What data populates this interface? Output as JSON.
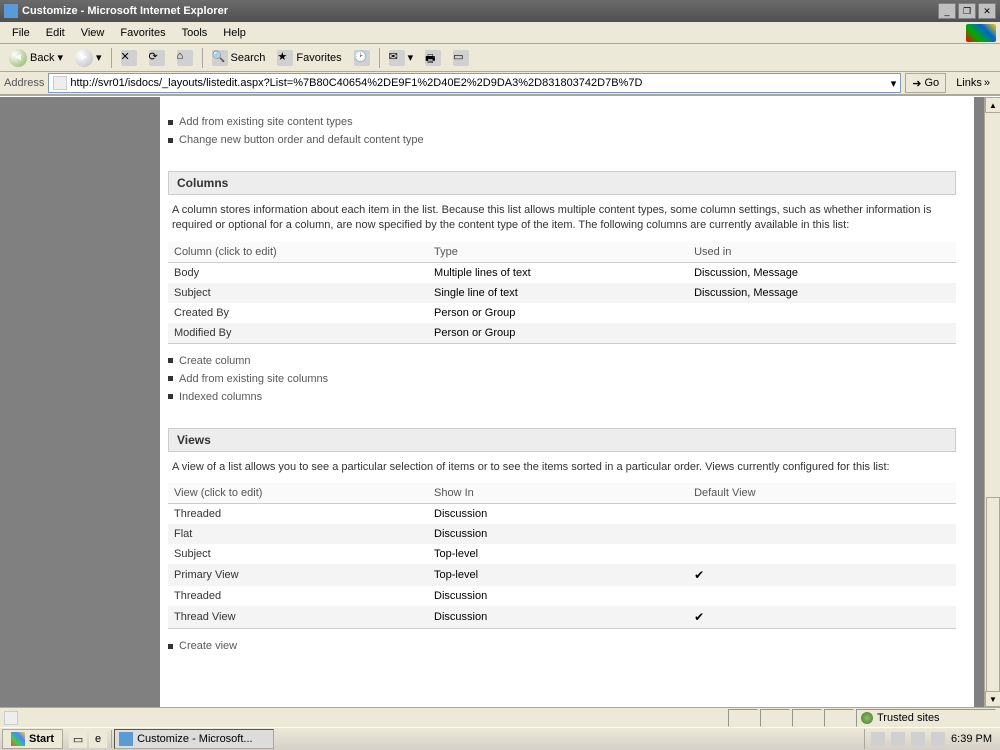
{
  "window": {
    "title": "Customize - Microsoft Internet Explorer"
  },
  "menu": {
    "file": "File",
    "edit": "Edit",
    "view": "View",
    "favorites": "Favorites",
    "tools": "Tools",
    "help": "Help"
  },
  "toolbar": {
    "back": "Back",
    "search": "Search",
    "favorites": "Favorites"
  },
  "address": {
    "label": "Address",
    "value": "http://svr01/isdocs/_layouts/listedit.aspx?List=%7B80C40654%2DE9F1%2D40E2%2D9DA3%2D831803742D7B%7D",
    "go": "Go",
    "links": "Links"
  },
  "content_types": {
    "actions": [
      "Add from existing site content types",
      "Change new button order and default content type"
    ]
  },
  "columns_section": {
    "heading": "Columns",
    "description": "A column stores information about each item in the list. Because this list allows multiple content types, some column settings, such as whether information is required or optional for a column, are now specified by the content type of the item. The following columns are currently available in this list:",
    "headers": {
      "col": "Column (click to edit)",
      "type": "Type",
      "usedin": "Used in"
    },
    "rows": [
      {
        "name": "Body",
        "type": "Multiple lines of text",
        "usedin": "Discussion, Message"
      },
      {
        "name": "Subject",
        "type": "Single line of text",
        "usedin": "Discussion, Message"
      },
      {
        "name": "Created By",
        "type": "Person or Group",
        "usedin": ""
      },
      {
        "name": "Modified By",
        "type": "Person or Group",
        "usedin": ""
      }
    ],
    "actions": [
      "Create column",
      "Add from existing site columns",
      "Indexed columns"
    ]
  },
  "views_section": {
    "heading": "Views",
    "description": "A view of a list allows you to see a particular selection of items or to see the items sorted in a particular order. Views currently configured for this list:",
    "headers": {
      "view": "View (click to edit)",
      "showin": "Show In",
      "default": "Default View"
    },
    "rows": [
      {
        "name": "Threaded",
        "showin": "Discussion",
        "default": false
      },
      {
        "name": "Flat",
        "showin": "Discussion",
        "default": false
      },
      {
        "name": "Subject",
        "showin": "Top-level",
        "default": false
      },
      {
        "name": "Primary View",
        "showin": "Top-level",
        "default": true
      },
      {
        "name": "Threaded",
        "showin": "Discussion",
        "default": false
      },
      {
        "name": "Thread View",
        "showin": "Discussion",
        "default": true
      }
    ],
    "actions": [
      "Create view"
    ]
  },
  "statusbar": {
    "zone": "Trusted sites"
  },
  "taskbar": {
    "start": "Start",
    "task": "Customize - Microsoft...",
    "clock": "6:39 PM"
  }
}
